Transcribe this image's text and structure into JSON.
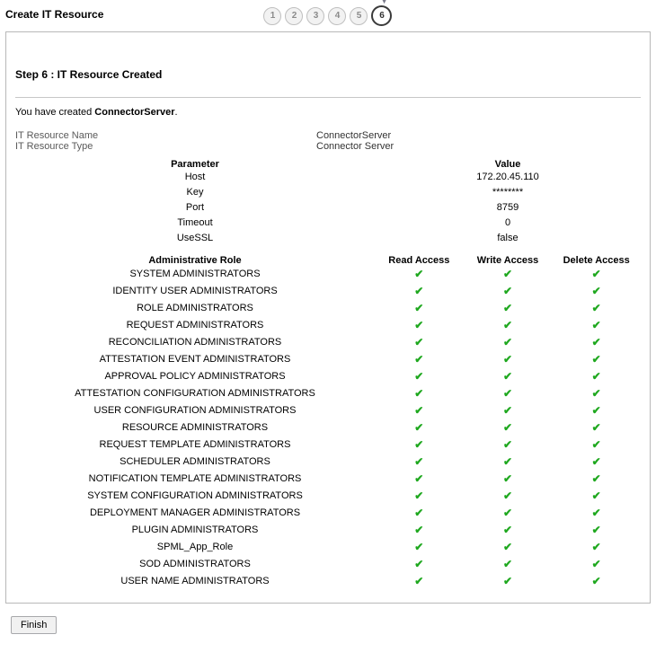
{
  "page_title": "Create IT Resource",
  "steps": [
    "1",
    "2",
    "3",
    "4",
    "5",
    "6"
  ],
  "current_step_index": 5,
  "panel": {
    "heading": "Step 6 : IT Resource Created",
    "created_prefix": "You have created ",
    "created_name": "ConnectorServer",
    "created_suffix": ".",
    "details": [
      {
        "label": "IT Resource Name",
        "value": "ConnectorServer"
      },
      {
        "label": "IT Resource Type",
        "value": "Connector Server"
      }
    ],
    "params": {
      "header_param": "Parameter",
      "header_value": "Value",
      "rows": [
        {
          "param": "Host",
          "value": "172.20.45.110"
        },
        {
          "param": "Key",
          "value": "********"
        },
        {
          "param": "Port",
          "value": "8759"
        },
        {
          "param": "Timeout",
          "value": "0"
        },
        {
          "param": "UseSSL",
          "value": "false"
        }
      ]
    },
    "roles": {
      "header_role": "Administrative Role",
      "header_read": "Read Access",
      "header_write": "Write Access",
      "header_delete": "Delete Access",
      "rows": [
        {
          "name": "SYSTEM ADMINISTRATORS",
          "read": true,
          "write": true,
          "delete": true
        },
        {
          "name": "IDENTITY USER ADMINISTRATORS",
          "read": true,
          "write": true,
          "delete": true
        },
        {
          "name": "ROLE ADMINISTRATORS",
          "read": true,
          "write": true,
          "delete": true
        },
        {
          "name": "REQUEST ADMINISTRATORS",
          "read": true,
          "write": true,
          "delete": true
        },
        {
          "name": "RECONCILIATION ADMINISTRATORS",
          "read": true,
          "write": true,
          "delete": true
        },
        {
          "name": "ATTESTATION EVENT ADMINISTRATORS",
          "read": true,
          "write": true,
          "delete": true
        },
        {
          "name": "APPROVAL POLICY ADMINISTRATORS",
          "read": true,
          "write": true,
          "delete": true
        },
        {
          "name": "ATTESTATION CONFIGURATION ADMINISTRATORS",
          "read": true,
          "write": true,
          "delete": true
        },
        {
          "name": "USER CONFIGURATION ADMINISTRATORS",
          "read": true,
          "write": true,
          "delete": true
        },
        {
          "name": "RESOURCE ADMINISTRATORS",
          "read": true,
          "write": true,
          "delete": true
        },
        {
          "name": "REQUEST TEMPLATE ADMINISTRATORS",
          "read": true,
          "write": true,
          "delete": true
        },
        {
          "name": "SCHEDULER ADMINISTRATORS",
          "read": true,
          "write": true,
          "delete": true
        },
        {
          "name": "NOTIFICATION TEMPLATE ADMINISTRATORS",
          "read": true,
          "write": true,
          "delete": true
        },
        {
          "name": "SYSTEM CONFIGURATION ADMINISTRATORS",
          "read": true,
          "write": true,
          "delete": true
        },
        {
          "name": "DEPLOYMENT MANAGER ADMINISTRATORS",
          "read": true,
          "write": true,
          "delete": true
        },
        {
          "name": "PLUGIN ADMINISTRATORS",
          "read": true,
          "write": true,
          "delete": true
        },
        {
          "name": "SPML_App_Role",
          "read": true,
          "write": true,
          "delete": true
        },
        {
          "name": "SOD ADMINISTRATORS",
          "read": true,
          "write": true,
          "delete": true
        },
        {
          "name": "USER NAME ADMINISTRATORS",
          "read": true,
          "write": true,
          "delete": true
        }
      ]
    }
  },
  "finish_label": "Finish"
}
